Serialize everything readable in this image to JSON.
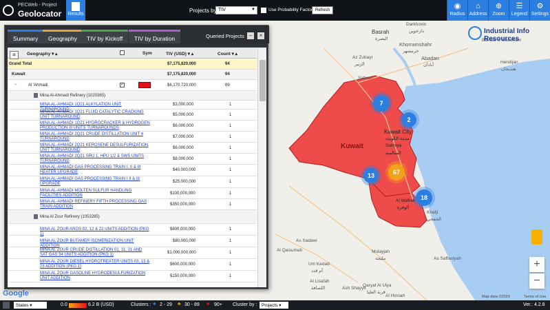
{
  "header": {
    "subtitle": "PECWeb - Project",
    "title": "Geolocator",
    "results_label": "Results",
    "projects_by_label": "Projects by",
    "projects_by_value": "TIV",
    "probability_label": "Use Probability Factors",
    "refresh_label": "Refresh",
    "tools": [
      {
        "label": "Radius",
        "icon": "radius-icon"
      },
      {
        "label": "Address",
        "icon": "address-icon"
      },
      {
        "label": "Zoom",
        "icon": "zoom-icon"
      },
      {
        "label": "Legend",
        "icon": "legend-icon"
      },
      {
        "label": "Settings",
        "icon": "gear-icon"
      }
    ]
  },
  "panel": {
    "tabs": [
      "Summary",
      "Geography",
      "TIV by Kickoff",
      "TIV by Duration"
    ],
    "queried_label": "Queried Projects",
    "columns": {
      "geography": "Geography",
      "sym": "Sym",
      "tiv": "TIV (USD)",
      "count": "Count"
    },
    "grand_total": {
      "label": "Grand Total",
      "tiv": "$7,175,820,000",
      "count": "94"
    },
    "country": {
      "label": "Kuwait",
      "tiv": "$7,175,820,000",
      "count": "94"
    },
    "region": {
      "label": "Al 'Ahmadi",
      "tiv": "$6,170,720,000",
      "count": "89",
      "sym_color": "#e4111b"
    },
    "refinery1": "Mina Al-Ahmadi Refinery (1020365)",
    "projects1": [
      {
        "name": "MINA AL-AHMADI 1Q21 ALKYLATION UNIT TURNAROUND",
        "tiv": "$3,000,000",
        "count": "1"
      },
      {
        "name": "MINA AL-AHMADI 1Q21 FLUID CATALYTIC CRACKING UNIT TURNAROUND",
        "tiv": "$5,000,000",
        "count": "1"
      },
      {
        "name": "MINA AL-AHMADI 1Q21 HYDROCRACKER & HYDROGEN PRODUCTION III UNITS TURNAROUNDS",
        "tiv": "$6,000,000",
        "count": "1"
      },
      {
        "name": "MINA AL-AHMADI 2Q21 CRUDE DISTILLATION UNIT 4 TURNAROUND",
        "tiv": "$7,000,000",
        "count": "1"
      },
      {
        "name": "MINA AL-AHMADI 2Q21 KEROSENE DESULFURIZATION UNIT TURNAROUND",
        "tiv": "$6,000,000",
        "count": "1"
      },
      {
        "name": "MINA AL-AHMADI 2Q21 SRU 1, HPU 1/2 & SWS UNITS TURNAROUND",
        "tiv": "$8,000,000",
        "count": "1"
      },
      {
        "name": "MINA AL-AHMADI GAS PROCESSING TRAIN I, II & III HEATER UPGRADE",
        "tiv": "$40,000,000",
        "count": "1"
      },
      {
        "name": "MINA AL-AHMADI GAS PROCESSING TRAIN I II & III UPGRADE",
        "tiv": "$25,000,000",
        "count": "1"
      },
      {
        "name": "MINA AL-AHMADI MOLTEN SULFUR HANDLING FACILITIES ADDITION",
        "tiv": "$100,000,000",
        "count": "1"
      },
      {
        "name": "MINA AL-AHMADI REFINERY FIFTH PROCESSING GAS TRAIN ADDITION",
        "tiv": "$350,000,000",
        "count": "1"
      }
    ],
    "refinery2": "Mina Al Zour Refinery (1053285)",
    "projects2": [
      {
        "name": "MINA AL ZOUR AROS 02, 12 & 22 UNITS ADDITION (PKG 1)",
        "tiv": "$800,000,000",
        "count": "1"
      },
      {
        "name": "MINA AL ZOUR BUTAMER ISOMERIZATION UNIT ADDITION",
        "tiv": "$80,000,000",
        "count": "1"
      },
      {
        "name": "MINA AL ZOUR CRUDE DISTILLATION 01, 11, 21 AND SAT GAS 34 UNITS ADDITION (PKG 1)",
        "tiv": "$1,000,000,000",
        "count": "1"
      },
      {
        "name": "MINA AL ZOUR DIESEL HYDROTREATER UNITS 03, 13 & 23 ADDITION (PKG 1)",
        "tiv": "$600,000,000",
        "count": "1"
      },
      {
        "name": "MINA AL ZOUR GASOLINE HYDRODESULFURIZATION UNIT ADDITION",
        "tiv": "$150,000,000",
        "count": "1"
      }
    ]
  },
  "map": {
    "labels": [
      {
        "text": "Basrah"
      },
      {
        "text": "البصرة"
      },
      {
        "text": "Az Zubayr"
      },
      {
        "text": "الزبير"
      },
      {
        "text": "Khorramshahr"
      },
      {
        "text": "خرمشهر"
      },
      {
        "text": "Abadan"
      },
      {
        "text": "آبادان"
      },
      {
        "text": "Darkhovin"
      },
      {
        "text": "دارخوین"
      },
      {
        "text": "Bandar-e Mahshahr"
      },
      {
        "text": "Hendijan"
      },
      {
        "text": "هندیجان"
      },
      {
        "text": "Kuwait City"
      },
      {
        "text": "مدينة الكويت"
      },
      {
        "text": "Salmiya"
      },
      {
        "text": "السالمية"
      },
      {
        "text": "Kuwait"
      },
      {
        "text": "Safwan"
      },
      {
        "text": "Al Wafrah"
      },
      {
        "text": "الوفرة"
      },
      {
        "text": "Khafji"
      },
      {
        "text": "الخفجي"
      },
      {
        "text": "As Sadawi"
      },
      {
        "text": "Al Qaisumah"
      },
      {
        "text": "Um Kedad"
      },
      {
        "text": "أم قدد"
      },
      {
        "text": "Mulayjah"
      },
      {
        "text": "مليجة"
      },
      {
        "text": "As Saffaniyah"
      },
      {
        "text": "Al Lisafah"
      },
      {
        "text": "اللصافة"
      },
      {
        "text": "Ash Shayyit"
      },
      {
        "text": "Qaryat Al Ulya"
      },
      {
        "text": "قرية العليا"
      },
      {
        "text": "Al Hinnah"
      }
    ],
    "clusters": [
      {
        "count": "7",
        "color": "#2c7ee0"
      },
      {
        "count": "2",
        "color": "#2c7ee0"
      },
      {
        "count": "13",
        "color": "#2c7ee0"
      },
      {
        "count": "67",
        "color": "#f4a11a"
      },
      {
        "count": "18",
        "color": "#2c7ee0"
      }
    ],
    "logo_text": "Industrial Info Resources",
    "google_label": "Google",
    "attribution": "Map data ©2020",
    "terms": "Terms of Use"
  },
  "footer": {
    "states_value": "States",
    "legend_min": "0.0",
    "legend_max": "6.2 B (USD)",
    "clusters_label": "Clusters :",
    "cluster_ranges": [
      "2 - 29",
      "30 - 89",
      "90+"
    ],
    "cluster_by_label": "Cluster by :",
    "cluster_by_value": "Projects",
    "version": "Ver.: 4.2.8"
  }
}
